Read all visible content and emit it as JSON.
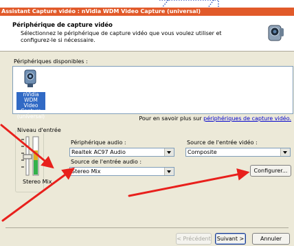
{
  "window": {
    "title": "Assistant Capture vidéo : nVidia WDM Video Capture (universal)"
  },
  "header": {
    "title": "Périphérique de capture vidéo",
    "subtitle": "Sélectionnez le périphérique de capture vidéo que vous voulez utiliser et configurez-le si nécessaire."
  },
  "devices": {
    "label": "Périphériques disponibles :",
    "items": [
      {
        "name": "nVidia WDM Video Capture (universal)",
        "selected": true
      }
    ],
    "info_prefix": "Pour en savoir plus sur ",
    "info_link": "périphériques de capture vidéo."
  },
  "level": {
    "title": "Niveau d'entrée",
    "mix_label": "Stereo Mix"
  },
  "audio": {
    "device_label": "Périphérique audio :",
    "device_value": "Realtek AC97 Audio",
    "source_label": "Source de l'entrée audio :",
    "source_value": "Stereo Mix"
  },
  "video": {
    "source_label": "Source de l'entrée vidéo :",
    "source_value": "Composite",
    "configure_label": "Configurer..."
  },
  "footer": {
    "prev_label": "< Précédent",
    "next_label": "Suivant >",
    "cancel_label": "Annuler"
  },
  "colors": {
    "titlebar": "#e15a2a",
    "dialog_bg": "#ece9d8",
    "selection": "#316ac5",
    "arrow": "#e8201c"
  }
}
